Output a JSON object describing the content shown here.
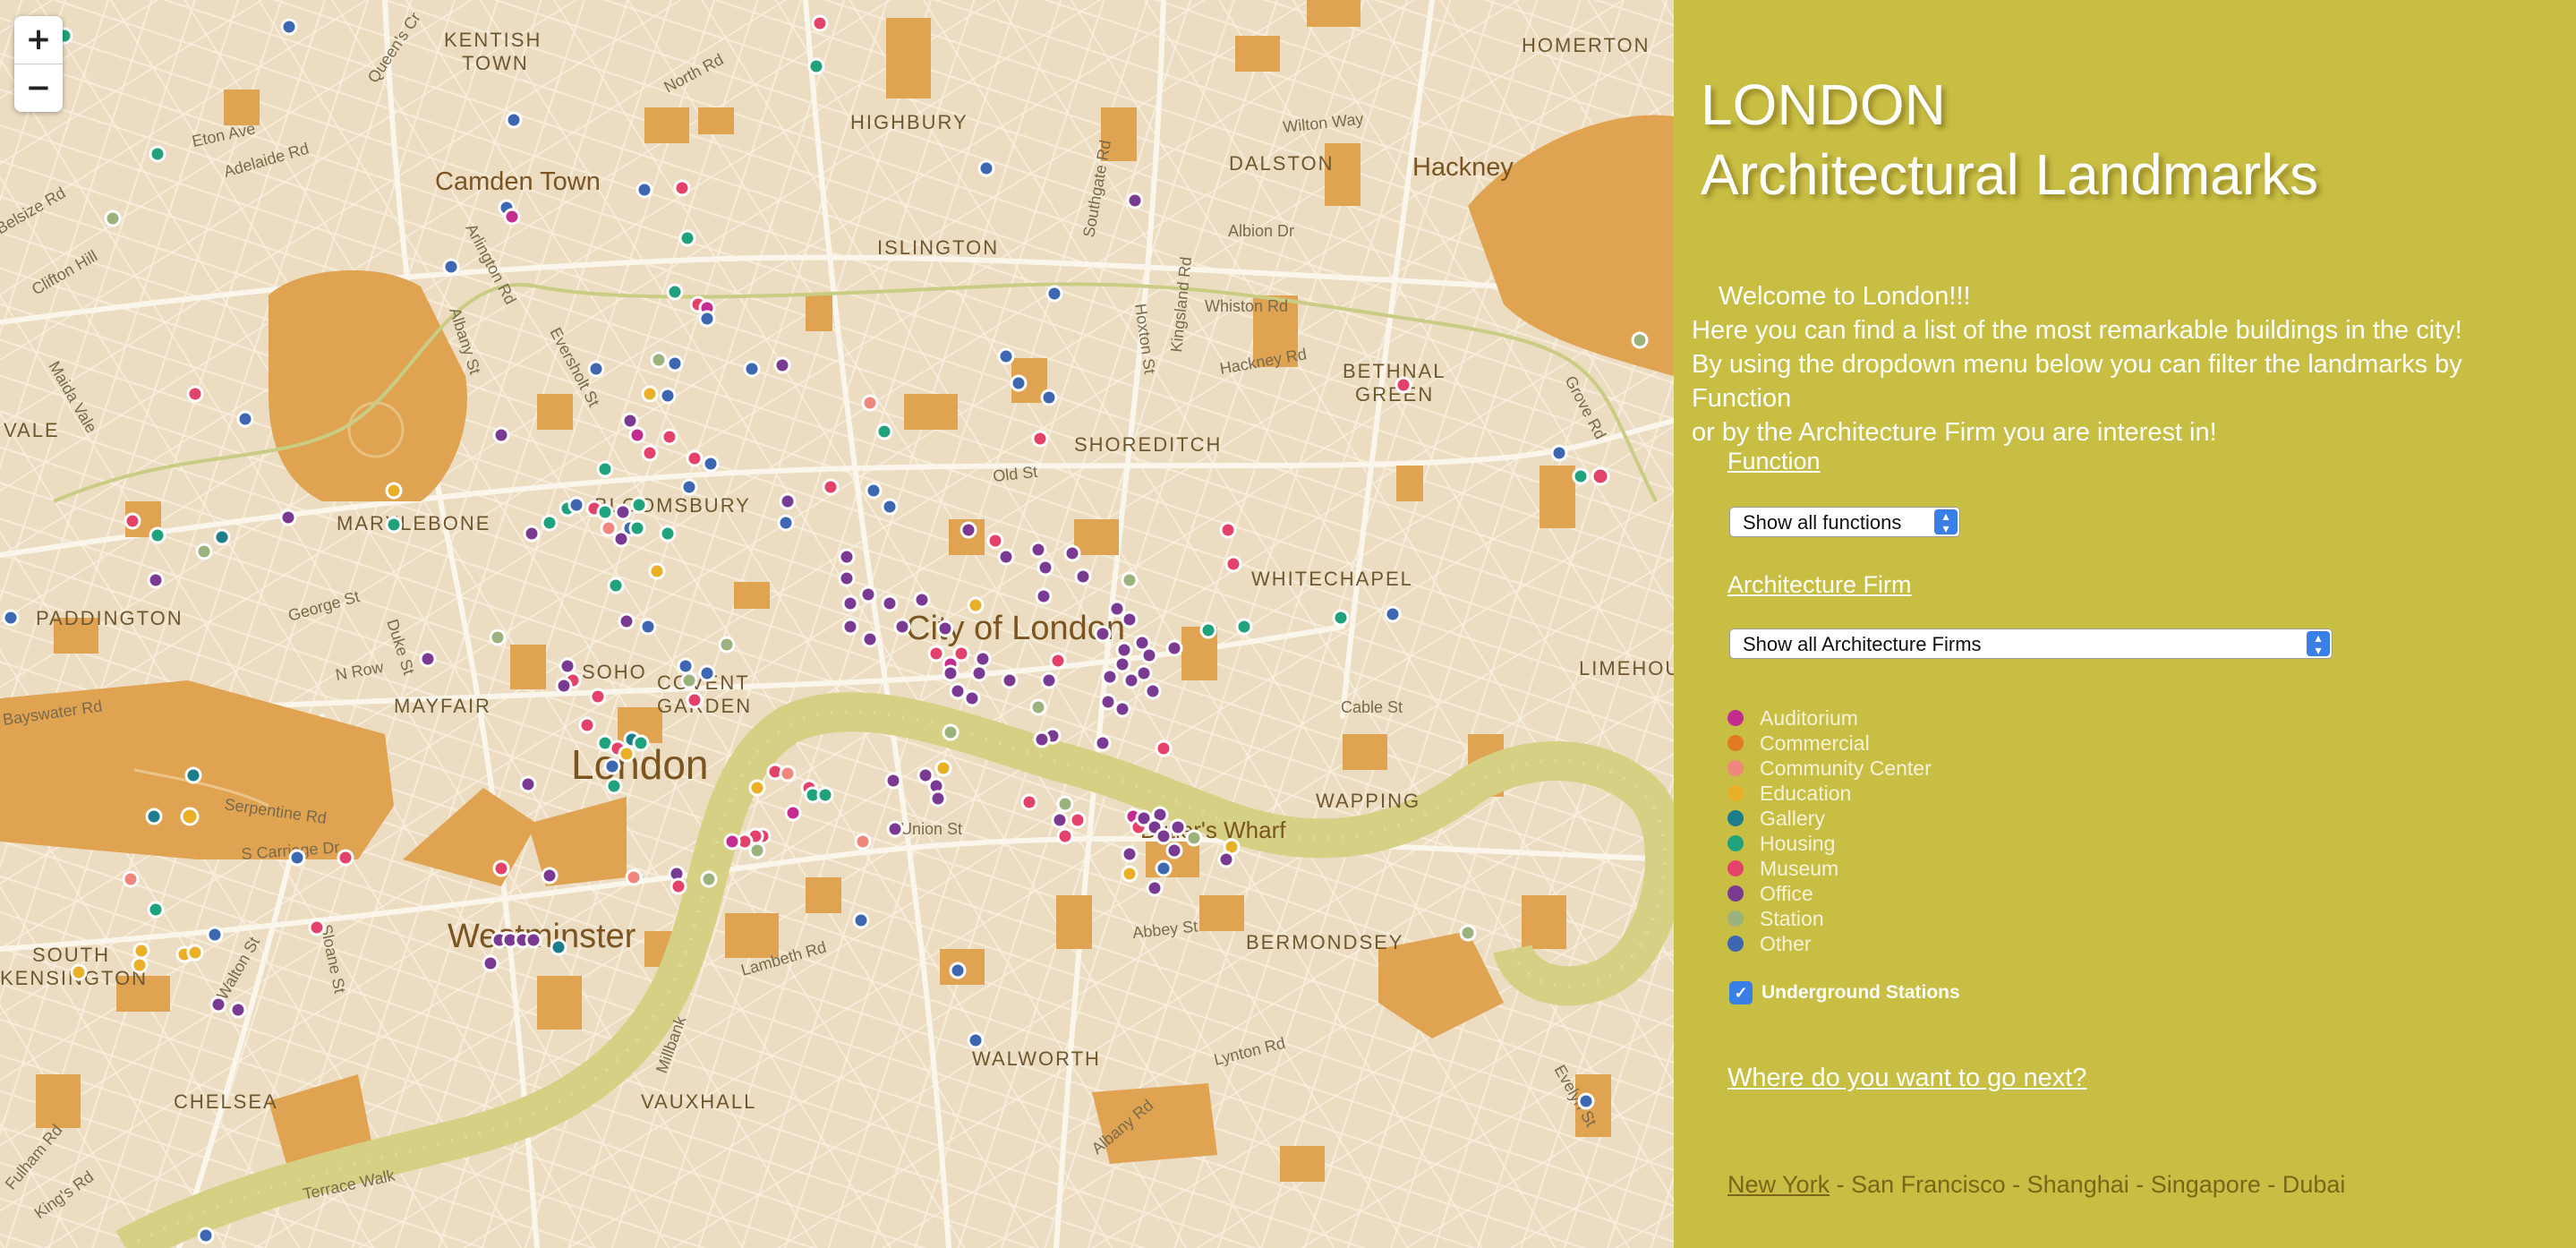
{
  "map": {
    "zoom_in": "+",
    "zoom_out": "−",
    "labels": {
      "kentish": "KENTISH",
      "town": "TOWN",
      "homerton": "HOMERTON",
      "camden": "Camden Town",
      "highbury": "HIGHBURY",
      "dalston": "DALSTON",
      "hackney": "Hackney",
      "islington": "ISLINGTON",
      "bethnal": "BETHNAL",
      "green": "GREEN",
      "shoreditch": "SHOREDITCH",
      "vale": "VALE",
      "marylebone": "MARYLEBONE",
      "bloomsbury": "BLOOMSBURY",
      "whitechapel": "WHITECHAPEL",
      "paddington": "PADDINGTON",
      "city": "City of London",
      "limehouse": "LIMEHOUSE",
      "soho": "SOHO",
      "covent": "COVENT",
      "garden": "GARDEN",
      "mayfair": "MAYFAIR",
      "london": "London",
      "wapping": "WAPPING",
      "butlers": "Butler's Wharf",
      "westminster": "Westminster",
      "bermondsey": "BERMONDSEY",
      "south": "SOUTH",
      "kensington": "KENSINGTON",
      "walworth": "WALWORTH",
      "chelsea": "CHELSEA",
      "vauxhall": "VAUXHALL",
      "serpentine": "Serpentine Rd",
      "carriage": "S Carriage Dr",
      "bayswater": "Bayswater Rd",
      "abbey": "Abbey St",
      "cable": "Cable St",
      "union": "Union St",
      "lambeth": "Lambeth Rd",
      "millbank": "Millbank",
      "terrace": "Terrace Walk",
      "kings": "King's Rd",
      "fulham": "Fulham Rd",
      "whiston": "Whiston Rd",
      "hackney_rd": "Hackney Rd",
      "albion": "Albion Dr",
      "wilton": "Wilton Way",
      "oldst": "Old St",
      "georgest": "George St",
      "nrow": "N Row",
      "dukest": "Duke St",
      "eversholt": "Eversholt St",
      "albany": "Albany St",
      "arlington": "Arlington Rd",
      "northrd": "North Rd",
      "eton": "Eton Ave",
      "adelaide": "Adelaide Rd",
      "belsize": "Belsize Rd",
      "clifton": "Clifton Hill",
      "maida": "Maida Vale",
      "southgate": "Southgate Rd",
      "kingsland": "Kingsland Rd",
      "hoxton": "Hoxton St",
      "grove": "Grove Rd",
      "lynton": "Lynton Rd",
      "albanyrd": "Albany Rd",
      "walton": "Walton St",
      "sloane": "Sloane St",
      "queens": "Queen's Cr",
      "evelyn": "Evelyn St"
    }
  },
  "panel": {
    "title_line1": "LONDON",
    "title_line2": "Architectural Landmarks",
    "intro_line1": "Welcome to London!!!",
    "intro_line2": "Here you can find a list of the most remarkable buildings in the city!",
    "intro_line3": "By using the dropdown menu below you can filter the landmarks by Function",
    "intro_line4": "or by the Architecture Firm you are interest in!",
    "function_heading": "Function",
    "function_select": "Show all functions",
    "firm_heading": "Architecture Firm",
    "firm_select": "Show all Architecture Firms",
    "legend": [
      {
        "label": "Auditorium",
        "color": "#c42d8f"
      },
      {
        "label": "Commercial",
        "color": "#e07a24"
      },
      {
        "label": "Community Center",
        "color": "#f0877c"
      },
      {
        "label": "Education",
        "color": "#e9b027"
      },
      {
        "label": "Gallery",
        "color": "#1c7d8c"
      },
      {
        "label": "Housing",
        "color": "#20a27c"
      },
      {
        "label": "Museum",
        "color": "#e3436a"
      },
      {
        "label": "Office",
        "color": "#7a3a91"
      },
      {
        "label": "Station",
        "color": "#9cb27c"
      },
      {
        "label": "Other",
        "color": "#3d67b0"
      }
    ],
    "underground_label": "Underground Stations",
    "underground_checked": true,
    "next_label": "Where do you want to go next?",
    "city_ny": "New York",
    "city_rest": " - San Francisco - Shanghai - Singapore - Dubai"
  }
}
